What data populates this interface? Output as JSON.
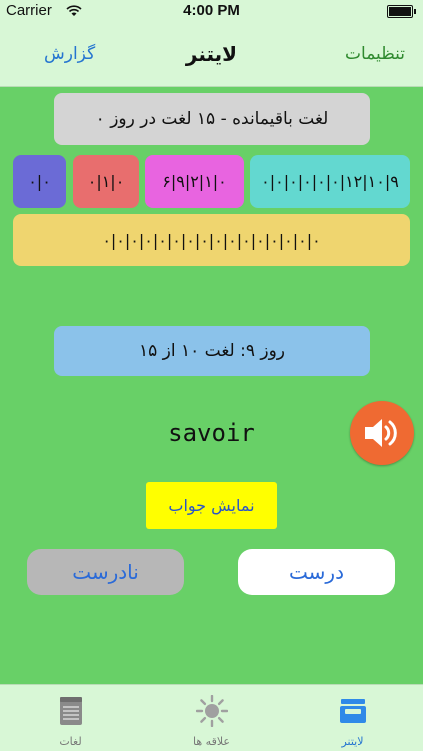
{
  "status": {
    "carrier": "Carrier",
    "time": "4:00 PM"
  },
  "nav": {
    "left": "گزارش",
    "title": "لایتنر",
    "right": "تنظیمات"
  },
  "summary": "۰ لغت باقیمانده - ۱۵ لغت در روز",
  "cells": [
    "۰|۰",
    "۰|۱|۰",
    "۶|۹|۲|۱|۰",
    "۰|۰|۰|۰|۰|۰|۱۲|۱۰|۹",
    "۰|۰|۰|۰|۰|۰|۰|۰|۰|۰|۰|۰|۰|۰|۰|۰"
  ],
  "day_info": "روز ۹: لغت ۱۰ از ۱۵",
  "word": "savoir",
  "show_answer": "نمایش جواب",
  "wrong": "نادرست",
  "correct": "درست",
  "tabs": [
    {
      "label": "لغات",
      "icon": "notepad-icon"
    },
    {
      "label": "علاقه ها",
      "icon": "sun-icon"
    },
    {
      "label": "لایتنر",
      "icon": "inbox-tray-icon"
    }
  ],
  "colors": {
    "accent": "#2575d0",
    "speaker": "#ef6a32",
    "background": "#68d067"
  }
}
